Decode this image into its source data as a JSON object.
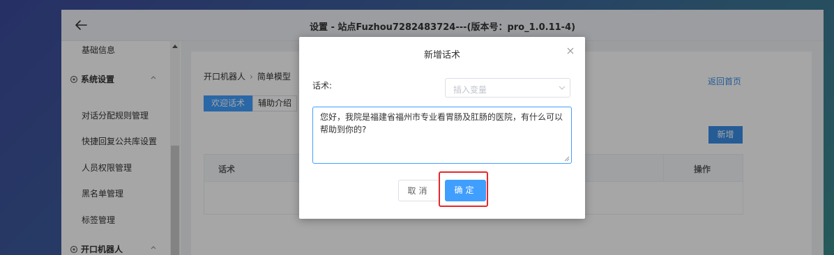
{
  "window": {
    "title": "设置 - 站点Fuzhou7282483724---(版本号：pro_1.0.11-4)"
  },
  "sidebar": {
    "items": [
      {
        "label": "基础信息",
        "type": "item"
      },
      {
        "label": "系统设置",
        "type": "group"
      },
      {
        "label": "对话分配规则管理",
        "type": "item"
      },
      {
        "label": "快捷回复公共库设置",
        "type": "item"
      },
      {
        "label": "人员权限管理",
        "type": "item"
      },
      {
        "label": "黑名单管理",
        "type": "item"
      },
      {
        "label": "标签管理",
        "type": "item"
      },
      {
        "label": "开口机器人",
        "type": "group"
      }
    ]
  },
  "main": {
    "breadcrumb": [
      "开口机器人",
      "简单模型"
    ],
    "home_link": "返回首页",
    "tabs": [
      {
        "label": "欢迎话术",
        "active": true
      },
      {
        "label": "辅助介绍",
        "active": false
      }
    ],
    "add_button": "新增",
    "table": {
      "columns": [
        "话术",
        "操作"
      ]
    }
  },
  "dialog": {
    "title": "新增话术",
    "field_label": "话术:",
    "select_placeholder": "插入变量",
    "textarea_value": "您好，我院是福建省福州市专业看胃肠及肛肠的医院，有什么可以帮助到你的?",
    "cancel_label": "取消",
    "confirm_label": "确定"
  },
  "colors": {
    "primary": "#409eff",
    "highlight": "#e8262b",
    "link": "#3a8ee6"
  },
  "icons": [
    "back-arrow-icon",
    "settings-gear-icon",
    "chevron-up-icon",
    "close-icon",
    "chevron-down-icon",
    "resize-grip-icon"
  ]
}
